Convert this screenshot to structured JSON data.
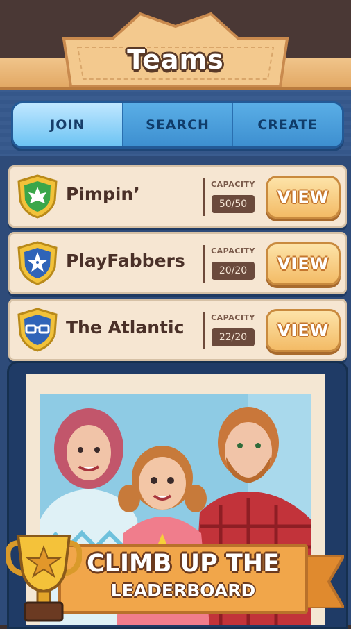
{
  "header": {
    "title": "Teams"
  },
  "tabs": [
    {
      "label": "JOIN",
      "active": true
    },
    {
      "label": "SEARCH",
      "active": false
    },
    {
      "label": "CREATE",
      "active": false
    }
  ],
  "capacity_label": "CAPACITY",
  "view_label": "VIEW",
  "teams": [
    {
      "name": "Pimpin’",
      "capacity": "50/50",
      "emblem": "leaf-icon",
      "emblem_color": "#3aa64a"
    },
    {
      "name": "PlayFabbers",
      "capacity": "20/20",
      "emblem": "star-icon",
      "emblem_color": "#2f64b8"
    },
    {
      "name": "The Atlantic",
      "capacity": "22/20",
      "emblem": "glasses-icon",
      "emblem_color": "#2f64b8"
    }
  ],
  "promo": {
    "line1": "CLIMB UP THE",
    "line2": "LEADERBOARD"
  },
  "colors": {
    "accent_blue": "#3f8fd1",
    "button_orange": "#f3bb66",
    "board_blue": "#2e4b79"
  }
}
